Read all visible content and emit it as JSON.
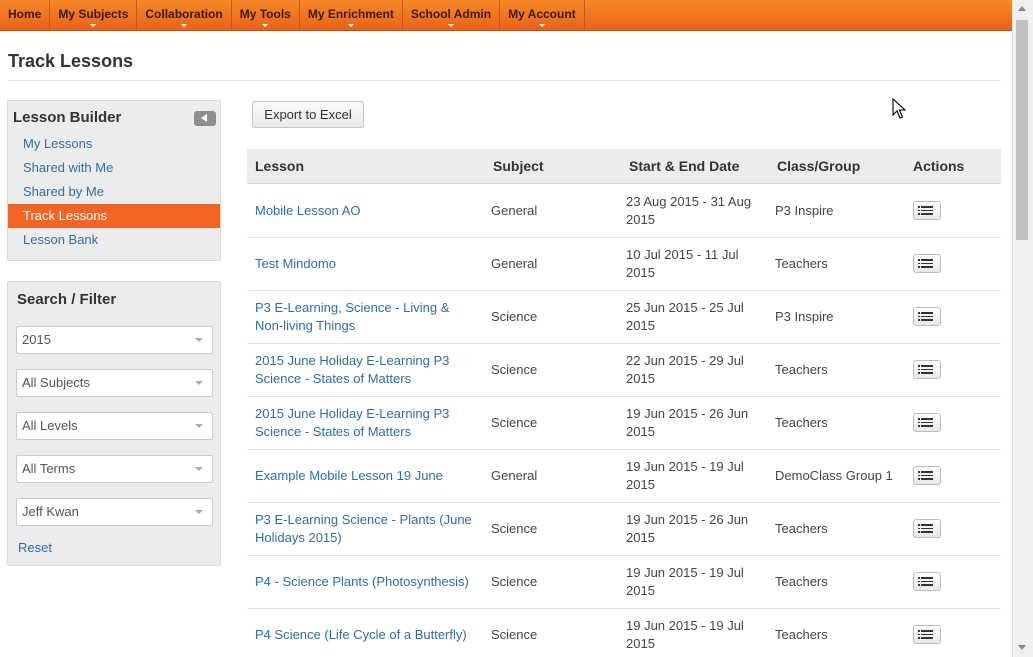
{
  "nav": {
    "items": [
      {
        "label": "Home",
        "caret": false
      },
      {
        "label": "My Subjects",
        "caret": true
      },
      {
        "label": "Collaboration",
        "caret": true
      },
      {
        "label": "My Tools",
        "caret": true
      },
      {
        "label": "My Enrichment",
        "caret": true
      },
      {
        "label": "School Admin",
        "caret": true
      },
      {
        "label": "My Account",
        "caret": true
      }
    ]
  },
  "page": {
    "title": "Track Lessons"
  },
  "builder": {
    "title": "Lesson Builder",
    "links": [
      "My Lessons",
      "Shared with Me",
      "Shared by Me",
      "Track Lessons",
      "Lesson Bank"
    ],
    "active_index": 3
  },
  "filter": {
    "title": "Search / Filter",
    "year": "2015",
    "subject": "All Subjects",
    "level": "All Levels",
    "term": "All Terms",
    "teacher": "Jeff Kwan",
    "reset": "Reset"
  },
  "export_label": "Export to Excel",
  "table": {
    "headers": {
      "lesson": "Lesson",
      "subject": "Subject",
      "dates": "Start & End Date",
      "class": "Class/Group",
      "actions": "Actions"
    },
    "rows": [
      {
        "lesson": "Mobile Lesson AO",
        "subject": "General",
        "dates": "23 Aug 2015 - 31 Aug 2015",
        "class": "P3 Inspire"
      },
      {
        "lesson": "Test Mindomo",
        "subject": "General",
        "dates": "10 Jul 2015 - 11 Jul 2015",
        "class": "Teachers"
      },
      {
        "lesson": "P3 E-Learning, Science - Living & Non-living Things",
        "subject": "Science",
        "dates": "25 Jun 2015 - 25 Jul 2015",
        "class": "P3 Inspire"
      },
      {
        "lesson": "2015 June Holiday E-Learning P3 Science - States of Matters",
        "subject": "Science",
        "dates": "22 Jun 2015 - 29 Jul 2015",
        "class": "Teachers"
      },
      {
        "lesson": "2015 June Holiday E-Learning P3 Science - States of Matters",
        "subject": "Science",
        "dates": "19 Jun 2015 - 26 Jun 2015",
        "class": "Teachers"
      },
      {
        "lesson": "Example Mobile Lesson 19 June",
        "subject": "General",
        "dates": "19 Jun 2015 - 19 Jul 2015",
        "class": "DemoClass Group 1"
      },
      {
        "lesson": "P3 E-Learning Science - Plants (June Holidays 2015)",
        "subject": "Science",
        "dates": "19 Jun 2015 - 26 Jun 2015",
        "class": "Teachers"
      },
      {
        "lesson": "P4 - Science Plants (Photosynthesis)",
        "subject": "Science",
        "dates": "19 Jun 2015 - 19 Jul 2015",
        "class": "Teachers"
      },
      {
        "lesson": "P4 Science (Life Cycle of a Butterfly)",
        "subject": "Science",
        "dates": "19 Jun 2015 - 19 Jul 2015",
        "class": "Teachers"
      }
    ]
  },
  "icons": {
    "action": "list-icon",
    "collapse": "chevron-left-icon",
    "dropdown": "chevron-down-icon"
  }
}
